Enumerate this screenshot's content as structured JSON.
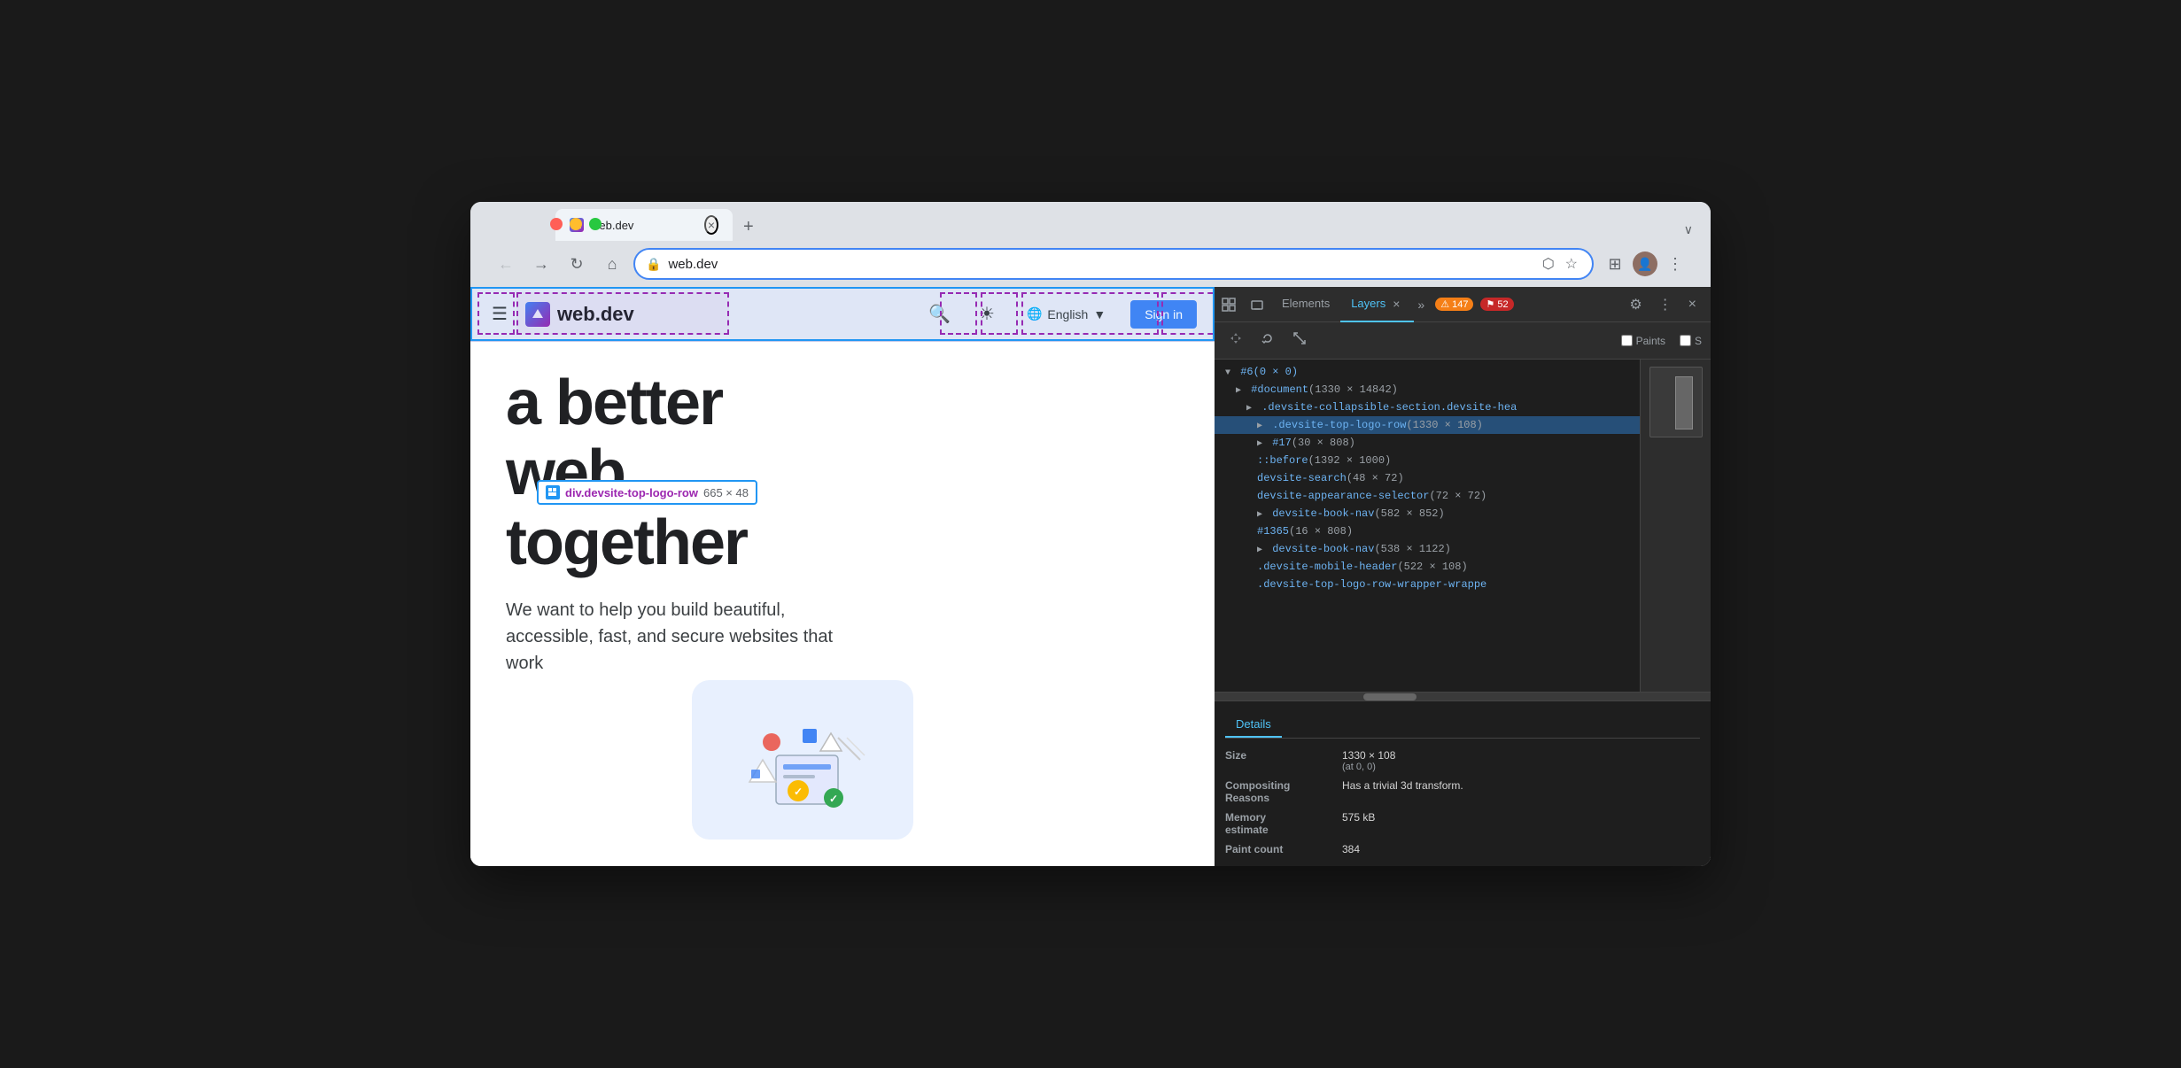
{
  "browser": {
    "window_controls": {
      "close_label": "×",
      "minimize_label": "−",
      "maximize_label": "+"
    },
    "tab": {
      "title": "web.dev",
      "close_icon": "×",
      "new_tab_icon": "+"
    },
    "address_bar": {
      "url": "web.dev",
      "back_icon": "←",
      "forward_icon": "→",
      "reload_icon": "↻",
      "home_icon": "⌂",
      "new_tab_icon": "⬡",
      "bookmark_icon": "☆",
      "extensions_icon": "⊞",
      "profile_icon": "👤",
      "more_icon": "⋮",
      "collapse_icon": "∨"
    }
  },
  "webpage": {
    "header": {
      "menu_icon": "☰",
      "logo_text": "web.dev",
      "search_icon": "🔍",
      "theme_icon": "☀",
      "globe_icon": "🌐",
      "language": "English",
      "lang_arrow": "▼",
      "sign_in": "Sign in"
    },
    "element_label": {
      "icon": "⊞",
      "name": "div.devsite-top-logo-row",
      "size": "665 × 48"
    },
    "hero": {
      "heading_line1": "a better",
      "heading_line2": "web,",
      "heading_line3": "together",
      "subtext": "We want to help you build beautiful, accessible, fast, and secure websites that work"
    }
  },
  "devtools": {
    "header": {
      "inspect_icon": "⊹",
      "device_icon": "⬜",
      "elements_tab": "Elements",
      "layers_tab": "Layers",
      "layers_close": "×",
      "more_tabs_icon": "»",
      "warnings_count": "147",
      "errors_count": "52",
      "warning_icon": "⚠",
      "error_icon": "⚑",
      "settings_icon": "⚙",
      "more_icon": "⋮",
      "close_icon": "×"
    },
    "second_bar": {
      "move_icon": "✛",
      "rotate_icon": "↺",
      "resize_icon": "⤢",
      "paints_label": "Paints",
      "s_label": "S"
    },
    "tree": {
      "root": "#6(0 × 0)",
      "items": [
        {
          "indent": 1,
          "text": "#document(1330 × 14842)",
          "selected": false
        },
        {
          "indent": 2,
          "text": ".devsite-collapsible-section.devsite-hea",
          "selected": false
        },
        {
          "indent": 3,
          "text": ".devsite-top-logo-row(1330 × 108)",
          "selected": true
        },
        {
          "indent": 4,
          "text": "#17(30 × 808)",
          "selected": false
        },
        {
          "indent": 4,
          "text": "::before(1392 × 1000)",
          "selected": false
        },
        {
          "indent": 4,
          "text": "devsite-search(48 × 72)",
          "selected": false
        },
        {
          "indent": 4,
          "text": "devsite-appearance-selector(72 × 72)",
          "selected": false
        },
        {
          "indent": 4,
          "text": "devsite-book-nav(582 × 852)",
          "selected": false
        },
        {
          "indent": 4,
          "text": "#1365(16 × 808)",
          "selected": false
        },
        {
          "indent": 4,
          "text": "devsite-book-nav(538 × 1122)",
          "selected": false
        },
        {
          "indent": 4,
          "text": ".devsite-mobile-header(522 × 108)",
          "selected": false
        },
        {
          "indent": 4,
          "text": ".devsite-top-logo-row-wrapper-wrappe",
          "selected": false
        }
      ]
    },
    "details": {
      "tab_label": "Details",
      "size_key": "Size",
      "size_val": "1330 × 108",
      "size_pos": "(at 0, 0)",
      "compositing_key": "Compositing\nReasons",
      "compositing_val": "Has a trivial 3d transform.",
      "memory_key": "Memory\nestimate",
      "memory_val": "575 kB",
      "paint_count_key": "Paint count",
      "paint_count_val": "384"
    }
  }
}
